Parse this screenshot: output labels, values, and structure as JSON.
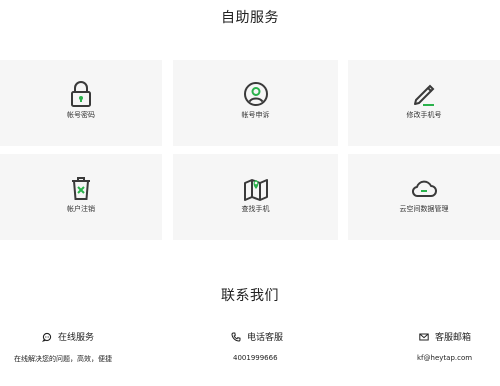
{
  "self_service": {
    "title": "自助服务",
    "items": [
      {
        "label": "帐号密码",
        "icon": "lock-icon"
      },
      {
        "label": "帐号申诉",
        "icon": "user-circle-icon"
      },
      {
        "label": "修改手机号",
        "icon": "pencil-icon"
      },
      {
        "label": "帐户注销",
        "icon": "trash-icon"
      },
      {
        "label": "查找手机",
        "icon": "map-pin-icon"
      },
      {
        "label": "云空间数据管理",
        "icon": "cloud-icon"
      }
    ]
  },
  "contact": {
    "title": "联系我们",
    "online": {
      "label": "在线服务",
      "desc": "在线解决您的问题，高效，便捷",
      "icon": "chat-support-icon"
    },
    "phone": {
      "label": "电话客服",
      "value": "4001999666",
      "icon": "phone-icon"
    },
    "email": {
      "label": "客服邮箱",
      "value": "kf@heytap.com",
      "icon": "mail-icon"
    }
  },
  "colors": {
    "accent": "#2bb24c",
    "icon_stroke": "#3a3a3a",
    "card_bg": "#f6f6f6"
  }
}
